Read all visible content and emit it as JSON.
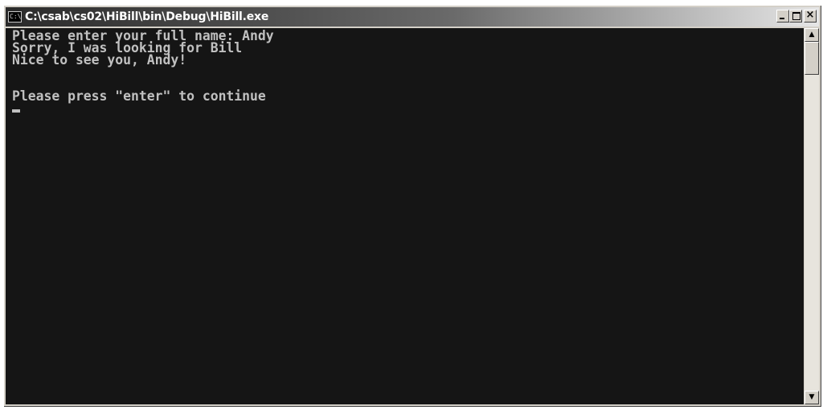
{
  "window": {
    "title": "C:\\csab\\cs02\\HiBill\\bin\\Debug\\HiBill.exe",
    "app_icon_text": "C:\\",
    "minimize_glyph": "",
    "maximize_glyph": "",
    "close_glyph": "×"
  },
  "console": {
    "lines": [
      "Please enter your full name: Andy",
      "Sorry, I was looking for Bill",
      "Nice to see you, Andy!",
      "",
      "",
      "Please press \"enter\" to continue"
    ],
    "text_color": "#c0c0c0",
    "background_color": "#151515"
  },
  "scrollbar": {
    "up_arrow": "▲",
    "down_arrow": "▼"
  }
}
